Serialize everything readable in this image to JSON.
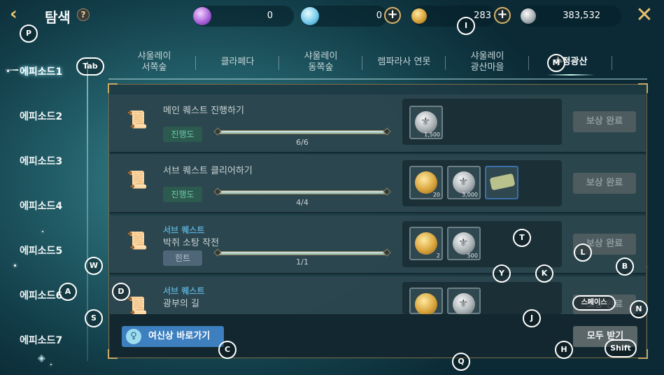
{
  "header": {
    "title": "탐색",
    "help_icon": "?",
    "close_icon": "✕",
    "back_icon": "‹"
  },
  "resources": [
    {
      "icon": "purple-gem-icon",
      "value": "0"
    },
    {
      "icon": "blue-crystal-icon",
      "value": "0"
    },
    {
      "icon": "gold-coin-icon",
      "value": "283"
    },
    {
      "icon": "silver-coin-icon",
      "value": "383,532"
    }
  ],
  "sidebar": {
    "items": [
      "에피소드1",
      "에피소드2",
      "에피소드3",
      "에피소드4",
      "에피소드5",
      "에피소드6",
      "에피소드7"
    ],
    "active_index": 0
  },
  "tabs": [
    {
      "label": "샤울레이\n서쪽숲"
    },
    {
      "label": "클라페다"
    },
    {
      "label": "샤울레이\n동쪽숲"
    },
    {
      "label": "렘파라사 연못"
    },
    {
      "label": "샤울레이\n광산마을"
    },
    {
      "label": "수정광산"
    }
  ],
  "quests": [
    {
      "category": "",
      "title": "메인 퀘스트 진행하기",
      "badge": "진행도",
      "progress": "6/6",
      "progress_fraction": 1.0,
      "rewards": [
        {
          "type": "silver",
          "qty": "1,500"
        }
      ],
      "claim": "보상 완료"
    },
    {
      "category": "",
      "title": "서브 퀘스트 클리어하기",
      "badge": "진행도",
      "progress": "4/4",
      "progress_fraction": 1.0,
      "rewards": [
        {
          "type": "gold",
          "qty": "20"
        },
        {
          "type": "silver",
          "qty": "3,000"
        },
        {
          "type": "scroll",
          "qty": ""
        }
      ],
      "claim": "보상 완료"
    },
    {
      "category": "서브 퀘스트",
      "title": "박쥐 소탕 작전",
      "badge": "힌트",
      "progress": "1/1",
      "progress_fraction": 1.0,
      "rewards": [
        {
          "type": "gold",
          "qty": "2"
        },
        {
          "type": "silver",
          "qty": "500"
        }
      ],
      "claim": "보상 완료"
    },
    {
      "category": "서브 퀘스트",
      "title": "광부의 길",
      "badge": "",
      "progress": "",
      "progress_fraction": 1.0,
      "rewards": [
        {
          "type": "gold",
          "qty": ""
        },
        {
          "type": "silver",
          "qty": ""
        }
      ],
      "claim": "보상 완료"
    }
  ],
  "footer": {
    "goddess_label": "여신상 바로가기",
    "claim_all_label": "모두 받기"
  },
  "hotkeys": {
    "p": "P",
    "tab": "Tab",
    "i": "I",
    "m": "M",
    "w": "W",
    "a": "A",
    "d": "D",
    "s": "S",
    "c": "C",
    "t": "T",
    "y": "Y",
    "k": "K",
    "l": "L",
    "b": "B",
    "j": "J",
    "n": "N",
    "h": "H",
    "q": "Q",
    "shift": "Shift",
    "space": "스페이스"
  }
}
